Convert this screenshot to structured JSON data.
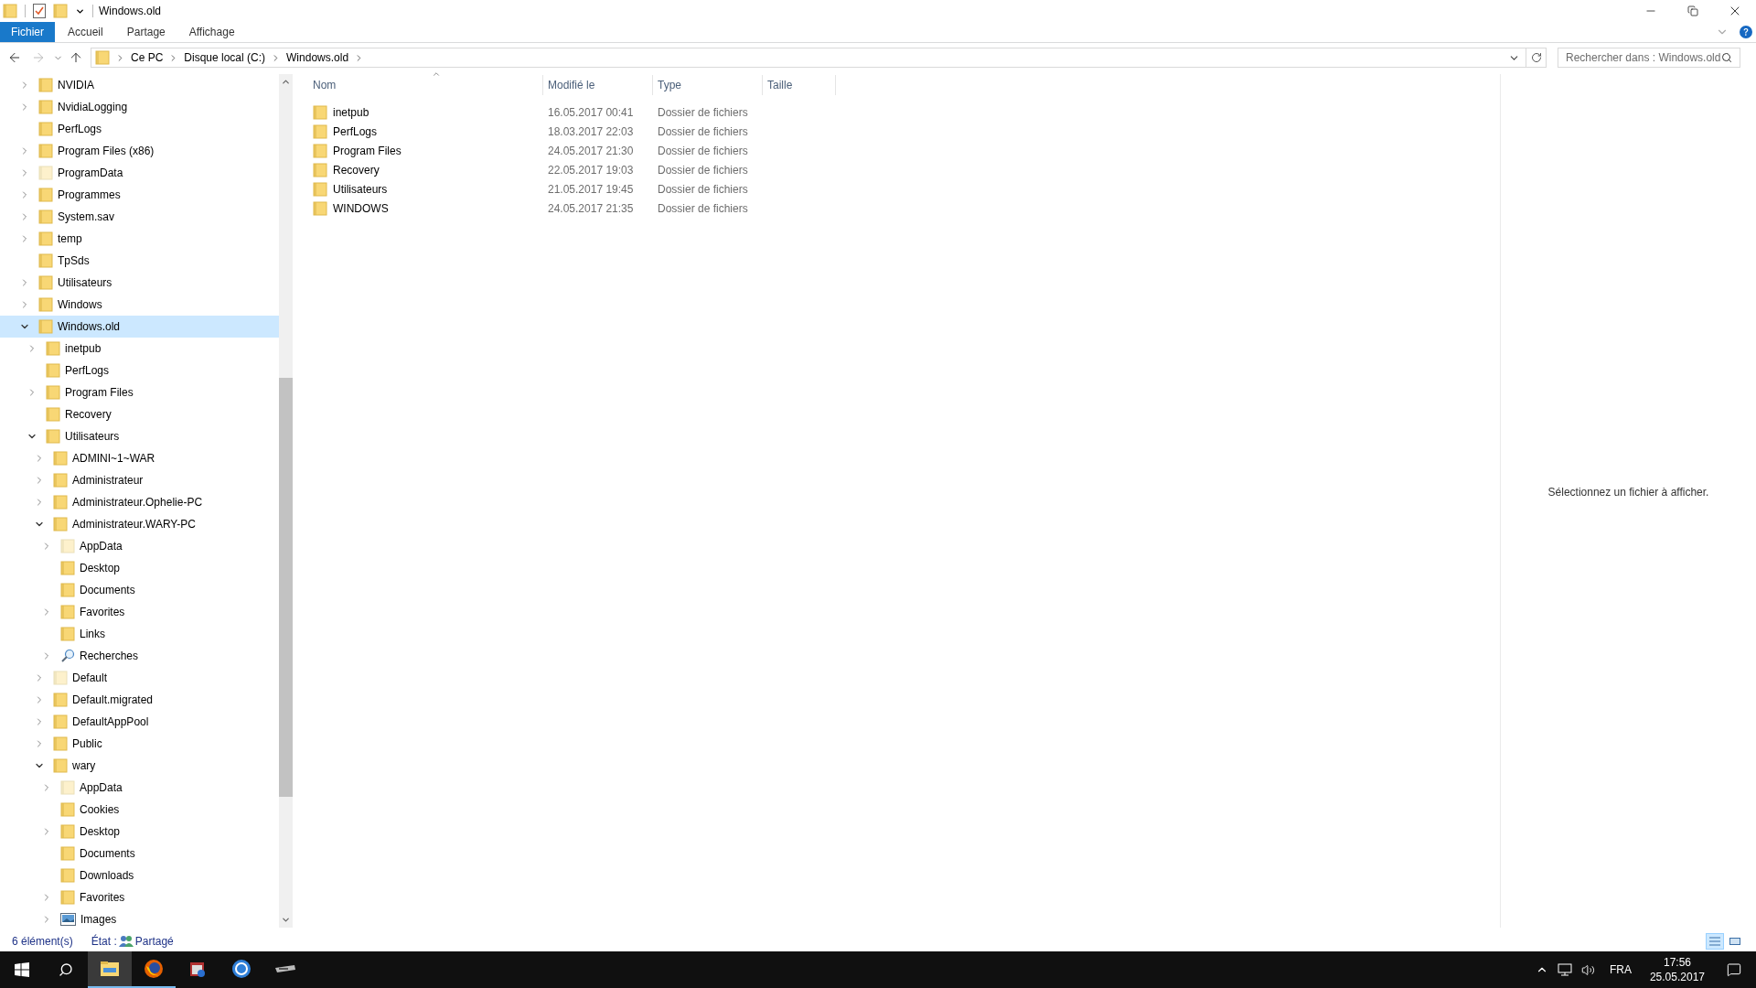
{
  "window": {
    "title": "Windows.old"
  },
  "ribbon_tabs": [
    {
      "label": "Fichier",
      "kind": "file"
    },
    {
      "label": "Accueil",
      "kind": "tab"
    },
    {
      "label": "Partage",
      "kind": "tab"
    },
    {
      "label": "Affichage",
      "kind": "tab"
    }
  ],
  "address": {
    "crumbs": [
      "Ce PC",
      "Disque local (C:)",
      "Windows.old"
    ]
  },
  "search": {
    "placeholder": "Rechercher dans : Windows.old"
  },
  "tree": [
    {
      "label": "NVIDIA",
      "kind": "folder",
      "expandable": true,
      "expanded": false,
      "selected": false
    },
    {
      "label": "NvidiaLogging",
      "kind": "folder",
      "expandable": true,
      "expanded": false,
      "selected": false
    },
    {
      "label": "PerfLogs",
      "kind": "folder",
      "expandable": false,
      "selected": false
    },
    {
      "label": "Program Files (x86)",
      "kind": "folder",
      "expandable": true,
      "expanded": false,
      "selected": false
    },
    {
      "label": "ProgramData",
      "kind": "faded",
      "expandable": true,
      "expanded": false,
      "selected": false
    },
    {
      "label": "Programmes",
      "kind": "folder",
      "expandable": true,
      "expanded": false,
      "selected": false
    },
    {
      "label": "System.sav",
      "kind": "folder",
      "expandable": true,
      "expanded": false,
      "selected": false
    },
    {
      "label": "temp",
      "kind": "folder",
      "expandable": true,
      "expanded": false,
      "selected": false
    },
    {
      "label": "TpSds",
      "kind": "folder",
      "expandable": false,
      "selected": false
    },
    {
      "label": "Utilisateurs",
      "kind": "folder",
      "expandable": true,
      "expanded": false,
      "selected": false
    },
    {
      "label": "Windows",
      "kind": "folder",
      "expandable": true,
      "expanded": false,
      "selected": false
    },
    {
      "label": "Windows.old",
      "kind": "folder",
      "expandable": true,
      "expanded": true,
      "selected": true,
      "children": [
        {
          "label": "inetpub",
          "kind": "folder",
          "expandable": true,
          "expanded": false,
          "selected": false
        },
        {
          "label": "PerfLogs",
          "kind": "folder",
          "expandable": false,
          "selected": false
        },
        {
          "label": "Program Files",
          "kind": "folder",
          "expandable": true,
          "expanded": false,
          "selected": false
        },
        {
          "label": "Recovery",
          "kind": "folder",
          "expandable": false,
          "selected": false
        },
        {
          "label": "Utilisateurs",
          "kind": "folder",
          "expandable": true,
          "expanded": true,
          "selected": false,
          "children": [
            {
              "label": "ADMINI~1~WAR",
              "kind": "folder",
              "expandable": true,
              "expanded": false,
              "selected": false
            },
            {
              "label": "Administrateur",
              "kind": "folder",
              "expandable": true,
              "expanded": false,
              "selected": false
            },
            {
              "label": "Administrateur.Ophelie-PC",
              "kind": "folder",
              "expandable": true,
              "expanded": false,
              "selected": false
            },
            {
              "label": "Administrateur.WARY-PC",
              "kind": "folder",
              "expandable": true,
              "expanded": true,
              "selected": false,
              "children": [
                {
                  "label": "AppData",
                  "kind": "faded",
                  "expandable": true,
                  "expanded": false,
                  "selected": false
                },
                {
                  "label": "Desktop",
                  "kind": "folder",
                  "expandable": false,
                  "selected": false
                },
                {
                  "label": "Documents",
                  "kind": "folder",
                  "expandable": false,
                  "selected": false
                },
                {
                  "label": "Favorites",
                  "kind": "folder",
                  "expandable": true,
                  "expanded": false,
                  "selected": false
                },
                {
                  "label": "Links",
                  "kind": "folder",
                  "expandable": false,
                  "selected": false
                },
                {
                  "label": "Recherches",
                  "kind": "search",
                  "expandable": true,
                  "expanded": false,
                  "selected": false
                }
              ]
            },
            {
              "label": "Default",
              "kind": "faded",
              "expandable": true,
              "expanded": false,
              "selected": false
            },
            {
              "label": "Default.migrated",
              "kind": "folder",
              "expandable": true,
              "expanded": false,
              "selected": false
            },
            {
              "label": "DefaultAppPool",
              "kind": "folder",
              "expandable": true,
              "expanded": false,
              "selected": false
            },
            {
              "label": "Public",
              "kind": "folder",
              "expandable": true,
              "expanded": false,
              "selected": false
            },
            {
              "label": "wary",
              "kind": "folder",
              "expandable": true,
              "expanded": true,
              "selected": false,
              "children": [
                {
                  "label": "AppData",
                  "kind": "faded",
                  "expandable": true,
                  "expanded": false,
                  "selected": false
                },
                {
                  "label": "Cookies",
                  "kind": "folder",
                  "expandable": false,
                  "selected": false
                },
                {
                  "label": "Desktop",
                  "kind": "folder",
                  "expandable": true,
                  "expanded": false,
                  "selected": false
                },
                {
                  "label": "Documents",
                  "kind": "folder",
                  "expandable": false,
                  "selected": false
                },
                {
                  "label": "Downloads",
                  "kind": "folder",
                  "expandable": false,
                  "selected": false
                },
                {
                  "label": "Favorites",
                  "kind": "folder",
                  "expandable": true,
                  "expanded": false,
                  "selected": false
                },
                {
                  "label": "Images",
                  "kind": "pictures",
                  "expandable": true,
                  "expanded": false,
                  "selected": false
                }
              ]
            }
          ]
        }
      ]
    }
  ],
  "file_list": {
    "columns": [
      "Nom",
      "Modifié le",
      "Type",
      "Taille"
    ],
    "rows": [
      {
        "name": "inetpub",
        "modified": "16.05.2017 00:41",
        "type": "Dossier de fichiers"
      },
      {
        "name": "PerfLogs",
        "modified": "18.03.2017 22:03",
        "type": "Dossier de fichiers"
      },
      {
        "name": "Program Files",
        "modified": "24.05.2017 21:30",
        "type": "Dossier de fichiers"
      },
      {
        "name": "Recovery",
        "modified": "22.05.2017 19:03",
        "type": "Dossier de fichiers"
      },
      {
        "name": "Utilisateurs",
        "modified": "21.05.2017 19:45",
        "type": "Dossier de fichiers"
      },
      {
        "name": "WINDOWS",
        "modified": "24.05.2017 21:35",
        "type": "Dossier de fichiers"
      }
    ]
  },
  "preview": {
    "message": "Sélectionnez un fichier à afficher."
  },
  "status_bar": {
    "count": "6 élément(s)",
    "state_label": "État :",
    "state_value": "Partagé",
    "views": [
      {
        "kind": "details",
        "selected": true
      },
      {
        "kind": "tiles",
        "selected": false
      }
    ]
  },
  "taskbar": {
    "apps": [
      {
        "kind": "explorer",
        "running": true,
        "selected": true
      },
      {
        "kind": "firefox",
        "running": true,
        "selected": false
      },
      {
        "kind": "app",
        "running": false,
        "selected": false
      },
      {
        "kind": "globe",
        "running": false,
        "selected": false
      },
      {
        "kind": "device",
        "running": false,
        "selected": false
      }
    ],
    "language": "FRA",
    "time": "17:56",
    "date": "25.05.2017"
  }
}
